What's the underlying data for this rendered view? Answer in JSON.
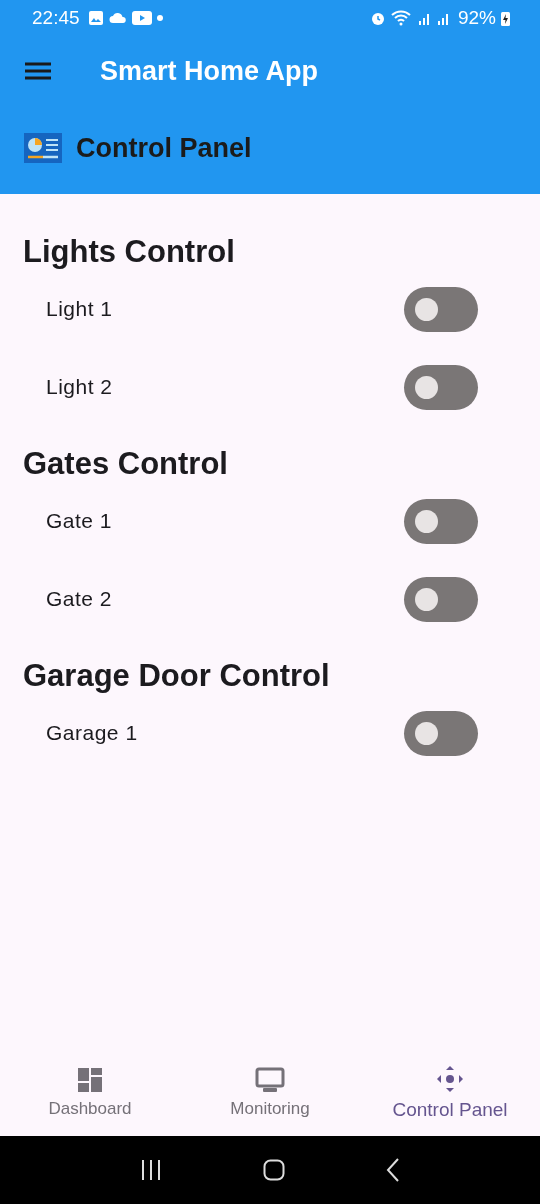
{
  "status_bar": {
    "time": "22:45",
    "battery": "92%"
  },
  "app_bar": {
    "title": "Smart Home App"
  },
  "panel_header": {
    "title": "Control Panel"
  },
  "sections": [
    {
      "title": "Lights Control",
      "devices": [
        {
          "name": "Light 1",
          "on": false
        },
        {
          "name": "Light 2",
          "on": false
        }
      ]
    },
    {
      "title": "Gates Control",
      "devices": [
        {
          "name": "Gate 1",
          "on": false
        },
        {
          "name": "Gate 2",
          "on": false
        }
      ]
    },
    {
      "title": "Garage Door Control",
      "devices": [
        {
          "name": "Garage 1",
          "on": false
        }
      ]
    }
  ],
  "bottom_nav": [
    {
      "label": "Dashboard",
      "kind": "dashboard",
      "selected": false
    },
    {
      "label": "Monitoring",
      "kind": "monitor",
      "selected": false
    },
    {
      "label": "Control Panel",
      "kind": "control",
      "selected": true
    }
  ]
}
